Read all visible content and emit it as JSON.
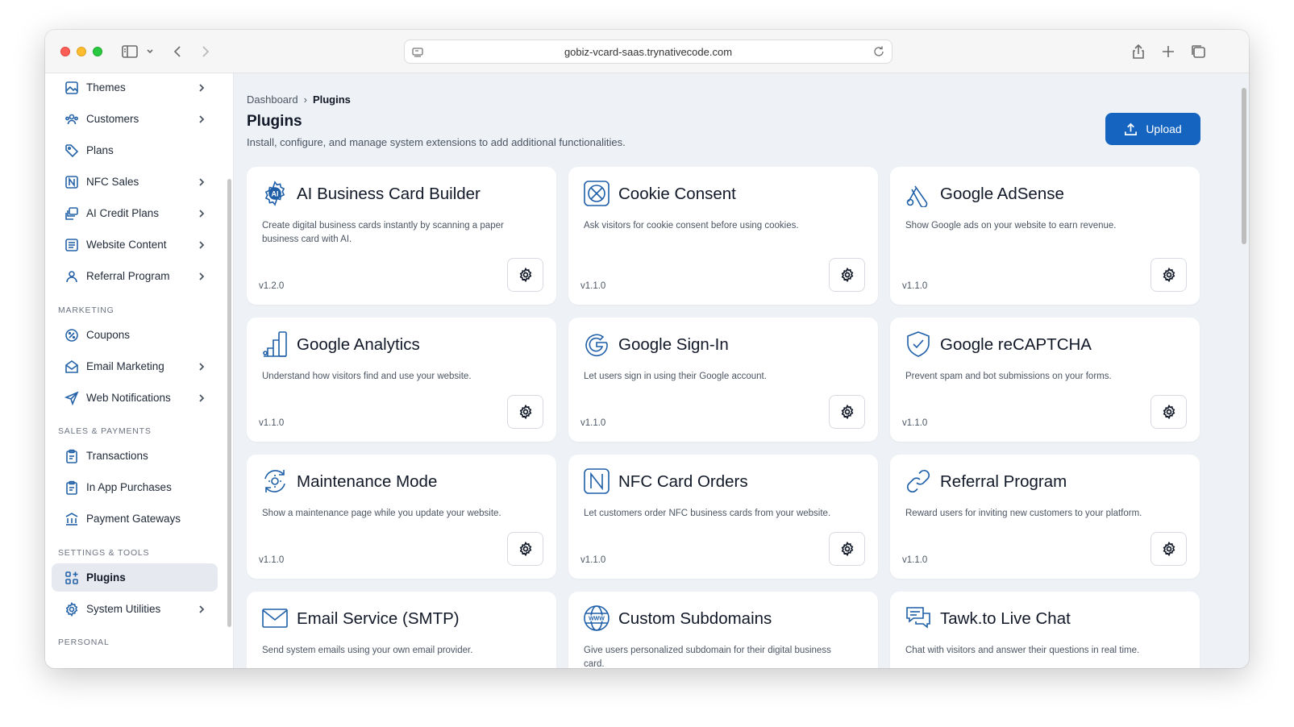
{
  "browser": {
    "url": "gobiz-vcard-saas.trynativecode.com"
  },
  "sidebar": {
    "items_top": [
      {
        "label": "Themes",
        "icon": "image-icon",
        "chevron": true
      },
      {
        "label": "Customers",
        "icon": "users-icon",
        "chevron": true
      },
      {
        "label": "Plans",
        "icon": "tag-icon",
        "chevron": false
      },
      {
        "label": "NFC Sales",
        "icon": "nfc-icon",
        "chevron": true
      },
      {
        "label": "AI Credit Plans",
        "icon": "stack-icon",
        "chevron": true
      },
      {
        "label": "Website Content",
        "icon": "document-icon",
        "chevron": true
      },
      {
        "label": "Referral Program",
        "icon": "user-icon",
        "chevron": true
      }
    ],
    "sections": {
      "marketing": "MARKETING",
      "sales": "SALES & PAYMENTS",
      "settings": "SETTINGS & TOOLS",
      "personal": "PERSONAL"
    },
    "items_marketing": [
      {
        "label": "Coupons",
        "icon": "discount-icon",
        "chevron": false
      },
      {
        "label": "Email Marketing",
        "icon": "mail-open-icon",
        "chevron": true
      },
      {
        "label": "Web Notifications",
        "icon": "send-icon",
        "chevron": true
      }
    ],
    "items_sales": [
      {
        "label": "Transactions",
        "icon": "clipboard-icon",
        "chevron": false
      },
      {
        "label": "In App Purchases",
        "icon": "clipboard-icon",
        "chevron": false
      },
      {
        "label": "Payment Gateways",
        "icon": "bank-icon",
        "chevron": false
      }
    ],
    "items_settings": [
      {
        "label": "Plugins",
        "icon": "apps-icon",
        "chevron": false,
        "active": true
      },
      {
        "label": "System Utilities",
        "icon": "gear-icon",
        "chevron": true
      }
    ]
  },
  "header": {
    "breadcrumb_root": "Dashboard",
    "breadcrumb_sep": "›",
    "breadcrumb_current": "Plugins",
    "title": "Plugins",
    "subtitle": "Install, configure, and manage system extensions to add additional functionalities.",
    "upload_label": "Upload"
  },
  "plugins": [
    {
      "title": "AI Business Card Builder",
      "desc": "Create digital business cards instantly by scanning a paper business card with AI.",
      "version": "v1.2.0",
      "icon": "ai-gear-icon"
    },
    {
      "title": "Cookie Consent",
      "desc": "Ask visitors for cookie consent before using cookies.",
      "version": "v1.1.0",
      "icon": "cookie-icon"
    },
    {
      "title": "Google AdSense",
      "desc": "Show Google ads on your website to earn revenue.",
      "version": "v1.1.0",
      "icon": "adsense-icon"
    },
    {
      "title": "Google Analytics",
      "desc": "Understand how visitors find and use your website.",
      "version": "v1.1.0",
      "icon": "analytics-icon"
    },
    {
      "title": "Google Sign-In",
      "desc": "Let users sign in using their Google account.",
      "version": "v1.1.0",
      "icon": "google-g-icon"
    },
    {
      "title": "Google reCAPTCHA",
      "desc": "Prevent spam and bot submissions on your forms.",
      "version": "v1.1.0",
      "icon": "shield-check-icon"
    },
    {
      "title": "Maintenance Mode",
      "desc": "Show a maintenance page while you update your website.",
      "version": "v1.1.0",
      "icon": "maintenance-icon"
    },
    {
      "title": "NFC Card Orders",
      "desc": "Let customers order NFC business cards from your website.",
      "version": "v1.1.0",
      "icon": "nfc-card-icon"
    },
    {
      "title": "Referral Program",
      "desc": "Reward users for inviting new customers to your platform.",
      "version": "v1.1.0",
      "icon": "link-icon"
    },
    {
      "title": "Email Service (SMTP)",
      "desc": "Send system emails using your own email provider.",
      "version": "",
      "icon": "envelope-icon"
    },
    {
      "title": "Custom Subdomains",
      "desc": "Give users personalized subdomain for their digital business card.",
      "version": "",
      "icon": "www-globe-icon"
    },
    {
      "title": "Tawk.to Live Chat",
      "desc": "Chat with visitors and answer their questions in real time.",
      "version": "",
      "icon": "chat-icon"
    }
  ],
  "colors": {
    "accent": "#1565c0",
    "icon": "#1e5fa8",
    "background": "#eef1f5"
  }
}
